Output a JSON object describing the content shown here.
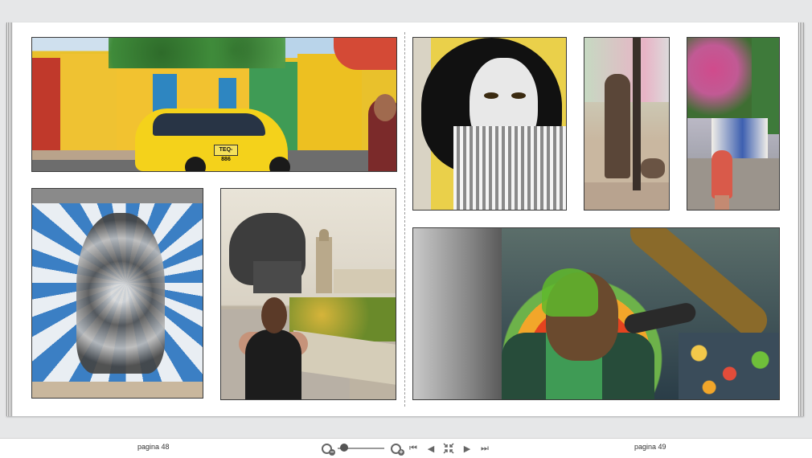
{
  "viewer": {
    "left_page_label": "pagina 48",
    "right_page_label": "pagina 49",
    "zoom_level": 0.05
  },
  "photos": {
    "taxi_plate": "TEQ-886"
  },
  "toolbar": {
    "icons": [
      "zoom-out-icon",
      "zoom-slider",
      "zoom-in-icon",
      "first-page-icon",
      "prev-page-icon",
      "fit-screen-icon",
      "next-page-icon",
      "last-page-icon"
    ]
  }
}
